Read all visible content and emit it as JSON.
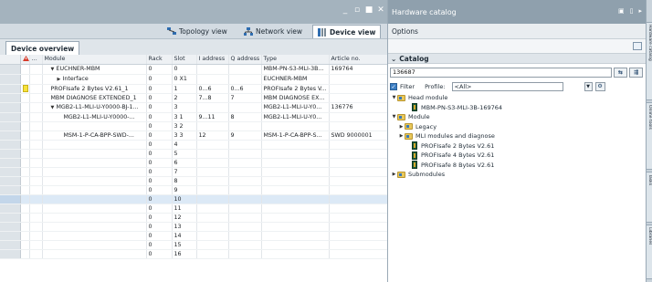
{
  "view_tabs": [
    {
      "label": "Topology view",
      "icon": "topology-icon",
      "active": false
    },
    {
      "label": "Network view",
      "icon": "network-icon",
      "active": false
    },
    {
      "label": "Device view",
      "icon": "device-icon",
      "active": true
    }
  ],
  "device_overview": {
    "tab_label": "Device overview",
    "columns": [
      "",
      "…",
      "Module",
      "Rack",
      "Slot",
      "I address",
      "Q address",
      "Type",
      "Article no."
    ],
    "rows": [
      {
        "expand": "down",
        "indent": 1,
        "module": "EUCHNER-MBM",
        "rack": "0",
        "slot": "0",
        "i_address": "",
        "q_address": "",
        "type": "MBM-PN-S3-MLI-3B...",
        "article": "169764"
      },
      {
        "expand": "right",
        "indent": 2,
        "module": "Interface",
        "rack": "0",
        "slot": "0 X1",
        "i_address": "",
        "q_address": "",
        "type": "EUCHNER-MBM",
        "article": ""
      },
      {
        "expand": "",
        "indent": 1,
        "module": "PROFIsafe 2 Bytes V2.61_1",
        "rack": "0",
        "slot": "1",
        "i_address": "0...6",
        "q_address": "0...6",
        "type": "PROFIsafe 2 Bytes V...",
        "article": "",
        "marker": "yellow"
      },
      {
        "expand": "",
        "indent": 1,
        "module": "MBM DIAGNOSE EXTENDED_1",
        "rack": "0",
        "slot": "2",
        "i_address": "7...8",
        "q_address": "7",
        "type": "MBM DIAGNOSE EX...",
        "article": ""
      },
      {
        "expand": "down",
        "indent": 1,
        "module": "MGB2-L1-MLI-U-Y0000-BJ-1...",
        "rack": "0",
        "slot": "3",
        "i_address": "",
        "q_address": "",
        "type": "MGB2-L1-MLI-U-Y0...",
        "article": "136776"
      },
      {
        "expand": "",
        "indent": 3,
        "module": "MGB2-L1-MLI-U-Y0000-...",
        "rack": "0",
        "slot": "3 1",
        "i_address": "9...11",
        "q_address": "8",
        "type": "MGB2-L1-MLI-U-Y0...",
        "article": ""
      },
      {
        "expand": "",
        "indent": 3,
        "module": "",
        "rack": "0",
        "slot": "3 2",
        "i_address": "",
        "q_address": "",
        "type": "",
        "article": ""
      },
      {
        "expand": "",
        "indent": 3,
        "module": "MSM-1-P-CA-BPP-SWD-...",
        "rack": "0",
        "slot": "3 3",
        "i_address": "12",
        "q_address": "9",
        "type": "MSM-1-P-CA-BPP-S...",
        "article": "SWD 9000001"
      },
      {
        "expand": "",
        "indent": 0,
        "module": "",
        "rack": "0",
        "slot": "4",
        "i_address": "",
        "q_address": "",
        "type": "",
        "article": ""
      },
      {
        "expand": "",
        "indent": 0,
        "module": "",
        "rack": "0",
        "slot": "5",
        "i_address": "",
        "q_address": "",
        "type": "",
        "article": ""
      },
      {
        "expand": "",
        "indent": 0,
        "module": "",
        "rack": "0",
        "slot": "6",
        "i_address": "",
        "q_address": "",
        "type": "",
        "article": ""
      },
      {
        "expand": "",
        "indent": 0,
        "module": "",
        "rack": "0",
        "slot": "7",
        "i_address": "",
        "q_address": "",
        "type": "",
        "article": ""
      },
      {
        "expand": "",
        "indent": 0,
        "module": "",
        "rack": "0",
        "slot": "8",
        "i_address": "",
        "q_address": "",
        "type": "",
        "article": ""
      },
      {
        "expand": "",
        "indent": 0,
        "module": "",
        "rack": "0",
        "slot": "9",
        "i_address": "",
        "q_address": "",
        "type": "",
        "article": ""
      },
      {
        "expand": "",
        "indent": 0,
        "module": "",
        "rack": "0",
        "slot": "10",
        "i_address": "",
        "q_address": "",
        "type": "",
        "article": "",
        "selected": true
      },
      {
        "expand": "",
        "indent": 0,
        "module": "",
        "rack": "0",
        "slot": "11",
        "i_address": "",
        "q_address": "",
        "type": "",
        "article": ""
      },
      {
        "expand": "",
        "indent": 0,
        "module": "",
        "rack": "0",
        "slot": "12",
        "i_address": "",
        "q_address": "",
        "type": "",
        "article": ""
      },
      {
        "expand": "",
        "indent": 0,
        "module": "",
        "rack": "0",
        "slot": "13",
        "i_address": "",
        "q_address": "",
        "type": "",
        "article": ""
      },
      {
        "expand": "",
        "indent": 0,
        "module": "",
        "rack": "0",
        "slot": "14",
        "i_address": "",
        "q_address": "",
        "type": "",
        "article": ""
      },
      {
        "expand": "",
        "indent": 0,
        "module": "",
        "rack": "0",
        "slot": "15",
        "i_address": "",
        "q_address": "",
        "type": "",
        "article": ""
      },
      {
        "expand": "",
        "indent": 0,
        "module": "",
        "rack": "0",
        "slot": "16",
        "i_address": "",
        "q_address": "",
        "type": "",
        "article": ""
      }
    ]
  },
  "catalog": {
    "title": "Hardware catalog",
    "options_label": "Options",
    "section_label": "Catalog",
    "search_value": "136687",
    "filter_label": "Filter",
    "profile_label": "Profile:",
    "profile_value": "<All>",
    "tree": [
      {
        "expand": "down",
        "indent": 0,
        "icon": "folder",
        "label": "Head module"
      },
      {
        "expand": "",
        "indent": 2,
        "icon": "module",
        "label": "MBM-PN-S3-MLI-3B-169764"
      },
      {
        "expand": "down",
        "indent": 0,
        "icon": "folder",
        "label": "Module"
      },
      {
        "expand": "right",
        "indent": 1,
        "icon": "folder",
        "label": "Legacy"
      },
      {
        "expand": "right",
        "indent": 1,
        "icon": "folder",
        "label": "MLI modules and diagnose"
      },
      {
        "expand": "",
        "indent": 2,
        "icon": "module",
        "label": "PROFIsafe 2 Bytes V2.61"
      },
      {
        "expand": "",
        "indent": 2,
        "icon": "module",
        "label": "PROFIsafe 4 Bytes V2.61"
      },
      {
        "expand": "",
        "indent": 2,
        "icon": "module",
        "label": "PROFIsafe 8 Bytes V2.61"
      },
      {
        "expand": "right",
        "indent": 0,
        "icon": "folder",
        "label": "Submodules"
      }
    ]
  },
  "side_tabs": [
    "Hardware catalog",
    "Online tools",
    "Tasks",
    "Libraries"
  ],
  "colors": {
    "titlebar": "#a4b3be",
    "catalog_titlebar": "#8fa0ad",
    "selection": "#dce9f6",
    "accent": "#3d7fc4"
  }
}
